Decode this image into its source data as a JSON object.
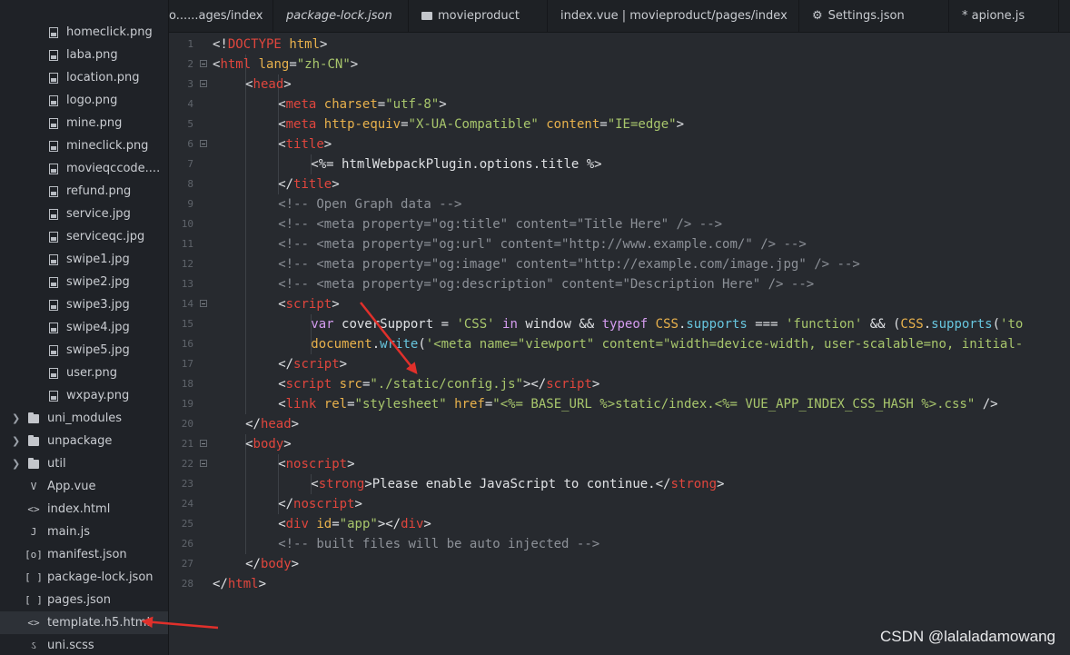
{
  "sidebar": {
    "items": [
      {
        "label": "homeclick.png",
        "kind": "image",
        "icon": "image-file-icon"
      },
      {
        "label": "laba.png",
        "kind": "image",
        "icon": "image-file-icon"
      },
      {
        "label": "location.png",
        "kind": "image",
        "icon": "image-file-icon"
      },
      {
        "label": "logo.png",
        "kind": "image",
        "icon": "image-file-icon"
      },
      {
        "label": "mine.png",
        "kind": "image",
        "icon": "image-file-icon"
      },
      {
        "label": "mineclick.png",
        "kind": "image",
        "icon": "image-file-icon"
      },
      {
        "label": "movieqccode....",
        "kind": "image",
        "icon": "image-file-icon"
      },
      {
        "label": "refund.png",
        "kind": "image",
        "icon": "image-file-icon"
      },
      {
        "label": "service.jpg",
        "kind": "image",
        "icon": "image-file-icon"
      },
      {
        "label": "serviceqc.jpg",
        "kind": "image",
        "icon": "image-file-icon"
      },
      {
        "label": "swipe1.jpg",
        "kind": "image",
        "icon": "image-file-icon"
      },
      {
        "label": "swipe2.jpg",
        "kind": "image",
        "icon": "image-file-icon"
      },
      {
        "label": "swipe3.jpg",
        "kind": "image",
        "icon": "image-file-icon"
      },
      {
        "label": "swipe4.jpg",
        "kind": "image",
        "icon": "image-file-icon"
      },
      {
        "label": "swipe5.jpg",
        "kind": "image",
        "icon": "image-file-icon"
      },
      {
        "label": "user.png",
        "kind": "image",
        "icon": "image-file-icon"
      },
      {
        "label": "wxpay.png",
        "kind": "image",
        "icon": "image-file-icon"
      },
      {
        "label": "uni_modules",
        "kind": "folder",
        "icon": "folder-icon"
      },
      {
        "label": "unpackage",
        "kind": "folder",
        "icon": "folder-icon"
      },
      {
        "label": "util",
        "kind": "folder",
        "icon": "folder-icon"
      },
      {
        "label": "App.vue",
        "kind": "root",
        "icon": "vue-file-icon",
        "glyph": "V"
      },
      {
        "label": "index.html",
        "kind": "root",
        "icon": "html-file-icon",
        "glyph": "<>"
      },
      {
        "label": "main.js",
        "kind": "root",
        "icon": "js-file-icon",
        "glyph": "J"
      },
      {
        "label": "manifest.json",
        "kind": "root",
        "icon": "manifest-file-icon",
        "glyph": "[o]"
      },
      {
        "label": "package-lock.json",
        "kind": "root",
        "icon": "json-file-icon",
        "glyph": "[ ]"
      },
      {
        "label": "pages.json",
        "kind": "root",
        "icon": "json-file-icon",
        "glyph": "[ ]"
      },
      {
        "label": "template.h5.html",
        "kind": "root",
        "icon": "html-file-icon",
        "glyph": "<>",
        "selected": true
      },
      {
        "label": "uni.scss",
        "kind": "root",
        "icon": "scss-file-icon",
        "glyph": "ઽ"
      }
    ]
  },
  "tabs": [
    {
      "label": "o......ages/index",
      "italic": false,
      "icon": ""
    },
    {
      "label": "package-lock.json",
      "italic": true,
      "icon": ""
    },
    {
      "label": "movieproduct",
      "italic": false,
      "icon": "folder-icon"
    },
    {
      "label": "index.vue | movieproduct/pages/index",
      "italic": false,
      "icon": ""
    },
    {
      "label": "Settings.json",
      "italic": false,
      "icon": "gear-icon"
    },
    {
      "label": "* apione.js",
      "italic": false,
      "icon": ""
    }
  ],
  "editor": {
    "lines": [
      {
        "n": "1",
        "fold": false,
        "indent": 0,
        "t": [
          [
            "tb",
            "<!"
          ],
          [
            "tg",
            "DOCTYPE"
          ],
          [
            "tb",
            " "
          ],
          [
            "at",
            "html"
          ],
          [
            "tb",
            ">"
          ]
        ]
      },
      {
        "n": "2",
        "fold": true,
        "indent": 0,
        "t": [
          [
            "tb",
            "<"
          ],
          [
            "tg",
            "html"
          ],
          [
            "tb",
            " "
          ],
          [
            "at",
            "lang"
          ],
          [
            "tb",
            "="
          ],
          [
            "st",
            "\"zh-CN\""
          ],
          [
            "tb",
            ">"
          ]
        ]
      },
      {
        "n": "3",
        "fold": true,
        "indent": 1,
        "t": [
          [
            "tb",
            "<"
          ],
          [
            "tg",
            "head"
          ],
          [
            "tb",
            ">"
          ]
        ]
      },
      {
        "n": "4",
        "fold": false,
        "indent": 2,
        "t": [
          [
            "tb",
            "<"
          ],
          [
            "tg",
            "meta"
          ],
          [
            "tb",
            " "
          ],
          [
            "at",
            "charset"
          ],
          [
            "tb",
            "="
          ],
          [
            "st",
            "\"utf-8\""
          ],
          [
            "tb",
            ">"
          ]
        ]
      },
      {
        "n": "5",
        "fold": false,
        "indent": 2,
        "t": [
          [
            "tb",
            "<"
          ],
          [
            "tg",
            "meta"
          ],
          [
            "tb",
            " "
          ],
          [
            "at",
            "http-equiv"
          ],
          [
            "tb",
            "="
          ],
          [
            "st",
            "\"X-UA-Compatible\""
          ],
          [
            "tb",
            " "
          ],
          [
            "at",
            "content"
          ],
          [
            "tb",
            "="
          ],
          [
            "st",
            "\"IE=edge\""
          ],
          [
            "tb",
            ">"
          ]
        ]
      },
      {
        "n": "6",
        "fold": true,
        "indent": 2,
        "t": [
          [
            "tb",
            "<"
          ],
          [
            "tg",
            "title"
          ],
          [
            "tb",
            ">"
          ]
        ]
      },
      {
        "n": "7",
        "fold": false,
        "indent": 3,
        "t": [
          [
            "tb",
            "<%= htmlWebpackPlugin.options.title %>"
          ]
        ]
      },
      {
        "n": "8",
        "fold": false,
        "indent": 2,
        "t": [
          [
            "tb",
            "</"
          ],
          [
            "tg",
            "title"
          ],
          [
            "tb",
            ">"
          ]
        ]
      },
      {
        "n": "9",
        "fold": false,
        "indent": 2,
        "t": [
          [
            "cm",
            "<!-- Open Graph data -->"
          ]
        ]
      },
      {
        "n": "10",
        "fold": false,
        "indent": 2,
        "t": [
          [
            "cm",
            "<!-- <meta property=\"og:title\" content=\"Title Here\" /> -->"
          ]
        ]
      },
      {
        "n": "11",
        "fold": false,
        "indent": 2,
        "t": [
          [
            "cm",
            "<!-- <meta property=\"og:url\" content=\"http://www.example.com/\" /> -->"
          ]
        ]
      },
      {
        "n": "12",
        "fold": false,
        "indent": 2,
        "t": [
          [
            "cm",
            "<!-- <meta property=\"og:image\" content=\"http://example.com/image.jpg\" /> -->"
          ]
        ]
      },
      {
        "n": "13",
        "fold": false,
        "indent": 2,
        "t": [
          [
            "cm",
            "<!-- <meta property=\"og:description\" content=\"Description Here\" /> -->"
          ]
        ]
      },
      {
        "n": "14",
        "fold": true,
        "indent": 2,
        "t": [
          [
            "tb",
            "<"
          ],
          [
            "tg",
            "script"
          ],
          [
            "tb",
            ">"
          ]
        ]
      },
      {
        "n": "15",
        "fold": false,
        "indent": 3,
        "t": [
          [
            "kw",
            "var"
          ],
          [
            "tb",
            " coverSupport = "
          ],
          [
            "st",
            "'CSS'"
          ],
          [
            "tb",
            " "
          ],
          [
            "kw",
            "in"
          ],
          [
            "tb",
            " window && "
          ],
          [
            "kw",
            "typeof"
          ],
          [
            "tb",
            " "
          ],
          [
            "ob",
            "CSS"
          ],
          [
            "tb",
            "."
          ],
          [
            "fn",
            "supports"
          ],
          [
            "tb",
            " === "
          ],
          [
            "st",
            "'function'"
          ],
          [
            "tb",
            " && ("
          ],
          [
            "ob",
            "CSS"
          ],
          [
            "tb",
            "."
          ],
          [
            "fn",
            "supports"
          ],
          [
            "tb",
            "("
          ],
          [
            "st",
            "'to"
          ]
        ]
      },
      {
        "n": "16",
        "fold": false,
        "indent": 3,
        "t": [
          [
            "ob",
            "document"
          ],
          [
            "tb",
            "."
          ],
          [
            "fn",
            "write"
          ],
          [
            "tb",
            "("
          ],
          [
            "st",
            "'<meta name=\"viewport\" content=\"width=device-width, user-scalable=no, initial-"
          ]
        ]
      },
      {
        "n": "17",
        "fold": false,
        "indent": 2,
        "t": [
          [
            "tb",
            "</"
          ],
          [
            "tg",
            "script"
          ],
          [
            "tb",
            ">"
          ]
        ]
      },
      {
        "n": "18",
        "fold": false,
        "indent": 2,
        "t": [
          [
            "tb",
            "<"
          ],
          [
            "tg",
            "script"
          ],
          [
            "tb",
            " "
          ],
          [
            "at",
            "src"
          ],
          [
            "tb",
            "="
          ],
          [
            "st",
            "\"./static/config.js\""
          ],
          [
            "tb",
            "></"
          ],
          [
            "tg",
            "script"
          ],
          [
            "tb",
            ">"
          ]
        ]
      },
      {
        "n": "19",
        "fold": false,
        "indent": 2,
        "t": [
          [
            "tb",
            "<"
          ],
          [
            "tg",
            "link"
          ],
          [
            "tb",
            " "
          ],
          [
            "at",
            "rel"
          ],
          [
            "tb",
            "="
          ],
          [
            "st",
            "\"stylesheet\""
          ],
          [
            "tb",
            " "
          ],
          [
            "at",
            "href"
          ],
          [
            "tb",
            "="
          ],
          [
            "st",
            "\"<%= BASE_URL %>static/index.<%= VUE_APP_INDEX_CSS_HASH %>.css\""
          ],
          [
            "tb",
            " />"
          ]
        ]
      },
      {
        "n": "20",
        "fold": false,
        "indent": 1,
        "t": [
          [
            "tb",
            "</"
          ],
          [
            "tg",
            "head"
          ],
          [
            "tb",
            ">"
          ]
        ]
      },
      {
        "n": "21",
        "fold": true,
        "indent": 1,
        "t": [
          [
            "tb",
            "<"
          ],
          [
            "tg",
            "body"
          ],
          [
            "tb",
            ">"
          ]
        ]
      },
      {
        "n": "22",
        "fold": true,
        "indent": 2,
        "t": [
          [
            "tb",
            "<"
          ],
          [
            "tg",
            "noscript"
          ],
          [
            "tb",
            ">"
          ]
        ]
      },
      {
        "n": "23",
        "fold": false,
        "indent": 3,
        "t": [
          [
            "tb",
            "<"
          ],
          [
            "tg",
            "strong"
          ],
          [
            "tb",
            ">Please enable JavaScript to continue.</"
          ],
          [
            "tg",
            "strong"
          ],
          [
            "tb",
            ">"
          ]
        ]
      },
      {
        "n": "24",
        "fold": false,
        "indent": 2,
        "t": [
          [
            "tb",
            "</"
          ],
          [
            "tg",
            "noscript"
          ],
          [
            "tb",
            ">"
          ]
        ]
      },
      {
        "n": "25",
        "fold": false,
        "indent": 2,
        "t": [
          [
            "tb",
            "<"
          ],
          [
            "tg",
            "div"
          ],
          [
            "tb",
            " "
          ],
          [
            "at",
            "id"
          ],
          [
            "tb",
            "="
          ],
          [
            "st",
            "\"app\""
          ],
          [
            "tb",
            "></"
          ],
          [
            "tg",
            "div"
          ],
          [
            "tb",
            ">"
          ]
        ]
      },
      {
        "n": "26",
        "fold": false,
        "indent": 2,
        "t": [
          [
            "cm",
            "<!-- built files will be auto injected -->"
          ]
        ]
      },
      {
        "n": "27",
        "fold": false,
        "indent": 1,
        "t": [
          [
            "tb",
            "</"
          ],
          [
            "tg",
            "body"
          ],
          [
            "tb",
            ">"
          ]
        ]
      },
      {
        "n": "28",
        "fold": false,
        "indent": 0,
        "t": [
          [
            "tb",
            "</"
          ],
          [
            "tg",
            "html"
          ],
          [
            "tb",
            ">"
          ]
        ]
      }
    ]
  },
  "colors": {
    "tag": "#e0463d",
    "attr": "#e8b14c",
    "string": "#a8c66c",
    "comment": "#8d9198",
    "keyword": "#d59cf0",
    "arrow": "#e0302b",
    "background": "#272a2f"
  },
  "watermark": "CSDN @lalaladamowang"
}
